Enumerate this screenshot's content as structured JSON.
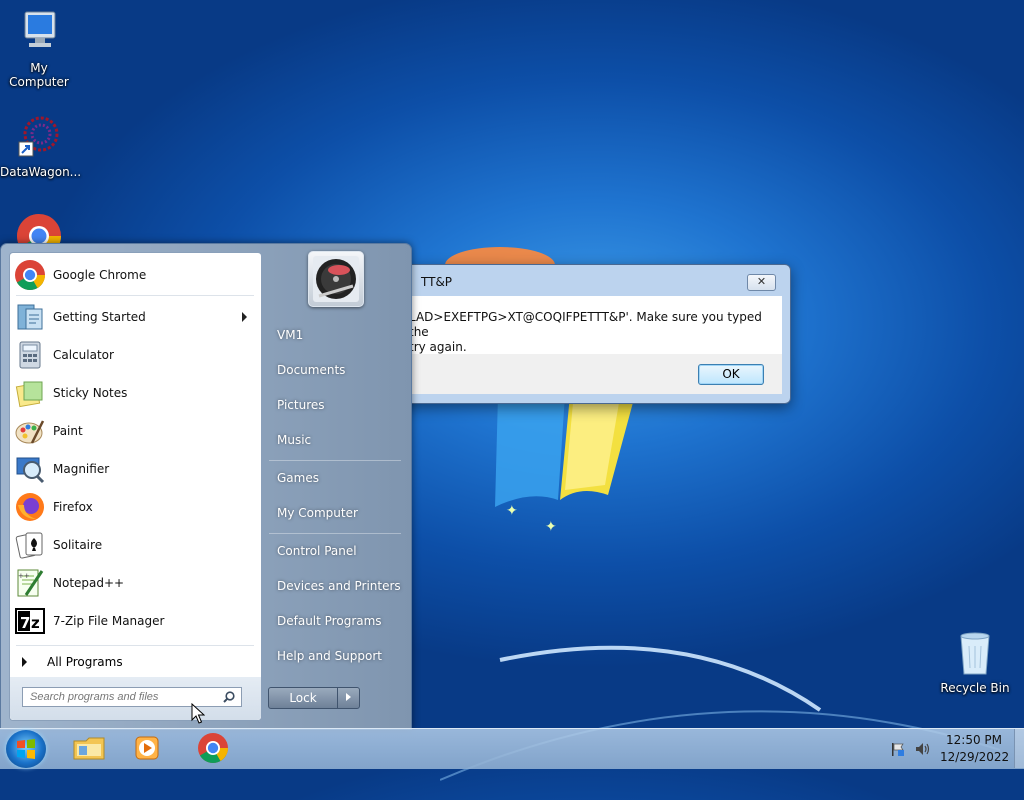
{
  "desktop": {
    "icons": [
      {
        "label": "My Computer"
      },
      {
        "label": "DataWagon..."
      },
      {
        "label": ""
      },
      {
        "label": "Recycle Bin"
      }
    ]
  },
  "dialog": {
    "title": "TT&P",
    "message_line1": "LAD>EXEFTPG>XT@COQIFPETTT&P'. Make sure you typed the",
    "message_line2": "try again.",
    "close_glyph": "✕",
    "ok_label": "OK"
  },
  "start_menu": {
    "programs": [
      {
        "label": "Google Chrome",
        "icon": "chrome-icon"
      },
      {
        "label": "Getting Started",
        "icon": "getting-started-icon",
        "has_submenu": true
      },
      {
        "label": "Calculator",
        "icon": "calculator-icon"
      },
      {
        "label": "Sticky Notes",
        "icon": "sticky-notes-icon"
      },
      {
        "label": "Paint",
        "icon": "paint-icon"
      },
      {
        "label": "Magnifier",
        "icon": "magnifier-icon"
      },
      {
        "label": "Firefox",
        "icon": "firefox-icon"
      },
      {
        "label": "Solitaire",
        "icon": "solitaire-icon"
      },
      {
        "label": "Notepad++",
        "icon": "notepadpp-icon"
      },
      {
        "label": "7-Zip File Manager",
        "icon": "sevenzip-icon"
      }
    ],
    "all_programs": "All Programs",
    "search_placeholder": "Search programs and files",
    "right_links": [
      {
        "label": "VM1"
      },
      {
        "label": "Documents"
      },
      {
        "label": "Pictures"
      },
      {
        "label": "Music"
      },
      {
        "label": "Games"
      },
      {
        "label": "My Computer"
      },
      {
        "label": "Control Panel"
      },
      {
        "label": "Devices and Printers"
      },
      {
        "label": "Default Programs"
      },
      {
        "label": "Help and Support"
      }
    ],
    "lock_label": "Lock"
  },
  "taskbar": {
    "pinned": [
      "windows-explorer-icon",
      "media-player-icon",
      "chrome-icon"
    ],
    "clock_time": "12:50 PM",
    "clock_date": "12/29/2022"
  },
  "colors": {
    "desktop_blue": "#1f74d0",
    "taskbar": "#a9c4e2",
    "start_menu_right": "#7f95af"
  }
}
